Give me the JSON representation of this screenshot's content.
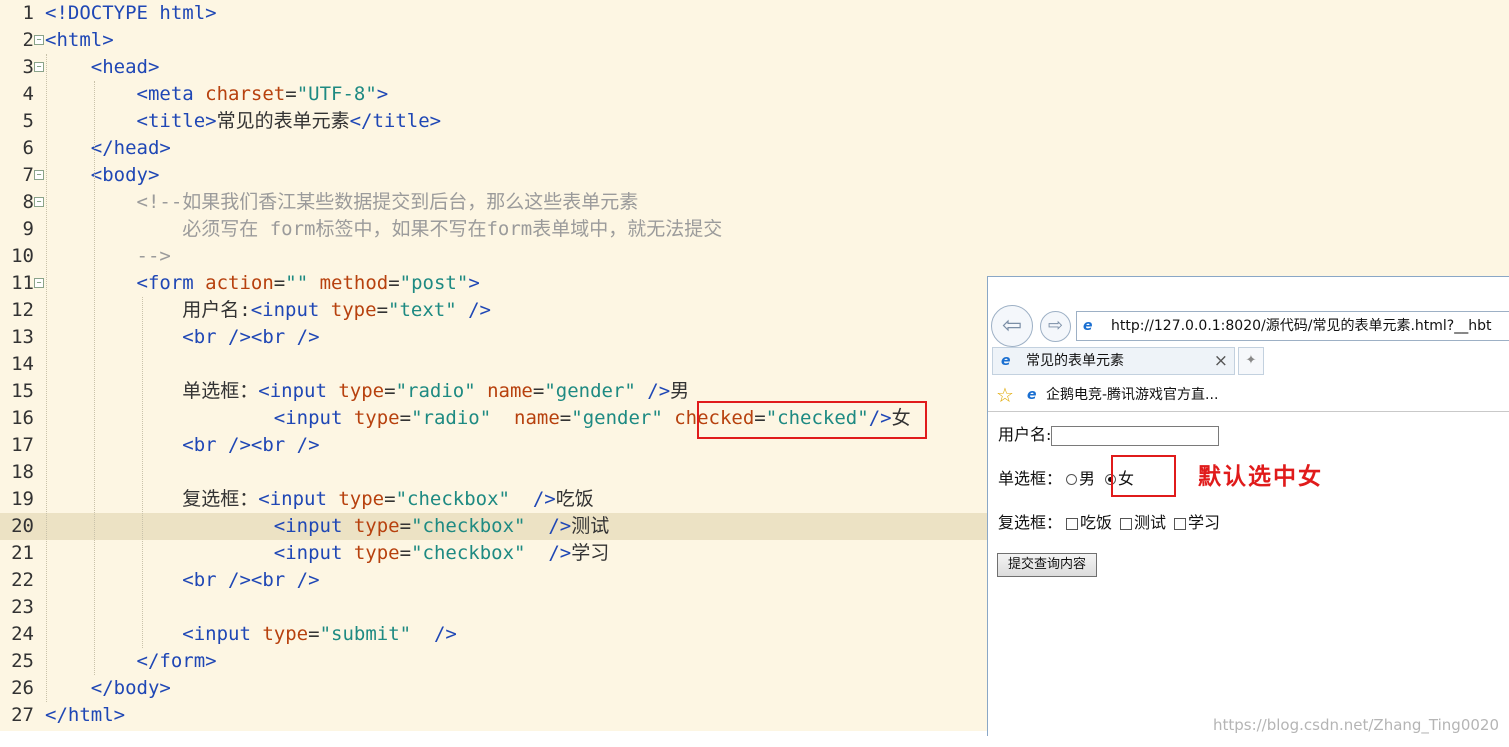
{
  "editor": {
    "lines": [
      {
        "num": "1",
        "fold": false,
        "segs": [
          [
            "tag",
            "<!DOCTYPE html>"
          ]
        ]
      },
      {
        "num": "2",
        "fold": true,
        "segs": [
          [
            "tag",
            "<html>"
          ]
        ]
      },
      {
        "num": "3",
        "fold": true,
        "segs": [
          [
            "txt",
            "    "
          ],
          [
            "tag",
            "<head>"
          ]
        ]
      },
      {
        "num": "4",
        "fold": false,
        "segs": [
          [
            "txt",
            "        "
          ],
          [
            "tag",
            "<meta "
          ],
          [
            "attr",
            "charset"
          ],
          [
            "txt",
            "="
          ],
          [
            "val",
            "\"UTF-8\""
          ],
          [
            "tag",
            ">"
          ]
        ]
      },
      {
        "num": "5",
        "fold": false,
        "segs": [
          [
            "txt",
            "        "
          ],
          [
            "tag",
            "<title>"
          ],
          [
            "txt",
            "常见的表单元素"
          ],
          [
            "tag",
            "</title>"
          ]
        ]
      },
      {
        "num": "6",
        "fold": false,
        "segs": [
          [
            "txt",
            "    "
          ],
          [
            "tag",
            "</head>"
          ]
        ]
      },
      {
        "num": "7",
        "fold": true,
        "segs": [
          [
            "txt",
            "    "
          ],
          [
            "tag",
            "<body>"
          ]
        ]
      },
      {
        "num": "8",
        "fold": true,
        "segs": [
          [
            "txt",
            "        "
          ],
          [
            "cmt",
            "<!--如果我们香江某些数据提交到后台，那么这些表单元素"
          ]
        ]
      },
      {
        "num": "9",
        "fold": false,
        "segs": [
          [
            "txt",
            "            "
          ],
          [
            "cmt",
            "必须写在 form标签中，如果不写在form表单域中，就无法提交"
          ]
        ]
      },
      {
        "num": "10",
        "fold": false,
        "segs": [
          [
            "txt",
            "        "
          ],
          [
            "cmt",
            "-->"
          ]
        ]
      },
      {
        "num": "11",
        "fold": true,
        "segs": [
          [
            "txt",
            "        "
          ],
          [
            "tag",
            "<form "
          ],
          [
            "attr",
            "action"
          ],
          [
            "txt",
            "="
          ],
          [
            "val",
            "\"\" "
          ],
          [
            "attr",
            "method"
          ],
          [
            "txt",
            "="
          ],
          [
            "val",
            "\"post\""
          ],
          [
            "tag",
            ">"
          ]
        ]
      },
      {
        "num": "12",
        "fold": false,
        "segs": [
          [
            "txt",
            "            用户名:"
          ],
          [
            "tag",
            "<input "
          ],
          [
            "attr",
            "type"
          ],
          [
            "txt",
            "="
          ],
          [
            "val",
            "\"text\" "
          ],
          [
            "tag",
            "/>"
          ]
        ]
      },
      {
        "num": "13",
        "fold": false,
        "segs": [
          [
            "txt",
            "            "
          ],
          [
            "tag",
            "<br /><br />"
          ]
        ]
      },
      {
        "num": "14",
        "fold": false,
        "segs": []
      },
      {
        "num": "15",
        "fold": false,
        "segs": [
          [
            "txt",
            "            单选框："
          ],
          [
            "tag",
            "<input "
          ],
          [
            "attr",
            "type"
          ],
          [
            "txt",
            "="
          ],
          [
            "val",
            "\"radio\" "
          ],
          [
            "attr",
            "name"
          ],
          [
            "txt",
            "="
          ],
          [
            "val",
            "\"gender\" "
          ],
          [
            "tag",
            "/>"
          ],
          [
            "txt",
            "男"
          ]
        ]
      },
      {
        "num": "16",
        "fold": false,
        "segs": [
          [
            "txt",
            "                    "
          ],
          [
            "tag",
            "<input "
          ],
          [
            "attr",
            "type"
          ],
          [
            "txt",
            "="
          ],
          [
            "val",
            "\"radio\"  "
          ],
          [
            "attr",
            "name"
          ],
          [
            "txt",
            "="
          ],
          [
            "val",
            "\"gender\" "
          ],
          [
            "attr",
            "checked"
          ],
          [
            "txt",
            "="
          ],
          [
            "val",
            "\"checked\""
          ],
          [
            "tag",
            "/>"
          ],
          [
            "txt",
            "女"
          ]
        ]
      },
      {
        "num": "17",
        "fold": false,
        "segs": [
          [
            "txt",
            "            "
          ],
          [
            "tag",
            "<br /><br />"
          ]
        ]
      },
      {
        "num": "18",
        "fold": false,
        "segs": []
      },
      {
        "num": "19",
        "fold": false,
        "segs": [
          [
            "txt",
            "            复选框："
          ],
          [
            "tag",
            "<input "
          ],
          [
            "attr",
            "type"
          ],
          [
            "txt",
            "="
          ],
          [
            "val",
            "\"checkbox\"  "
          ],
          [
            "tag",
            "/>"
          ],
          [
            "txt",
            "吃饭"
          ]
        ]
      },
      {
        "num": "20",
        "fold": false,
        "segs": [
          [
            "txt",
            "                    "
          ],
          [
            "tag",
            "<input "
          ],
          [
            "attr",
            "type"
          ],
          [
            "txt",
            "="
          ],
          [
            "val",
            "\"checkbox\"  "
          ],
          [
            "tag",
            "/>"
          ],
          [
            "txt",
            "测试"
          ]
        ]
      },
      {
        "num": "21",
        "fold": false,
        "segs": [
          [
            "txt",
            "                    "
          ],
          [
            "tag",
            "<input "
          ],
          [
            "attr",
            "type"
          ],
          [
            "txt",
            "="
          ],
          [
            "val",
            "\"checkbox\"  "
          ],
          [
            "tag",
            "/>"
          ],
          [
            "txt",
            "学习"
          ]
        ]
      },
      {
        "num": "22",
        "fold": false,
        "segs": [
          [
            "txt",
            "            "
          ],
          [
            "tag",
            "<br /><br />"
          ]
        ]
      },
      {
        "num": "23",
        "fold": false,
        "segs": []
      },
      {
        "num": "24",
        "fold": false,
        "segs": [
          [
            "txt",
            "            "
          ],
          [
            "tag",
            "<input "
          ],
          [
            "attr",
            "type"
          ],
          [
            "txt",
            "="
          ],
          [
            "val",
            "\"submit\"  "
          ],
          [
            "tag",
            "/>"
          ]
        ]
      },
      {
        "num": "25",
        "fold": false,
        "segs": [
          [
            "txt",
            "        "
          ],
          [
            "tag",
            "</form>"
          ]
        ]
      },
      {
        "num": "26",
        "fold": false,
        "segs": [
          [
            "txt",
            "    "
          ],
          [
            "tag",
            "</body>"
          ]
        ]
      },
      {
        "num": "27",
        "fold": false,
        "segs": [
          [
            "tag",
            "</html>"
          ]
        ]
      }
    ],
    "highlighted_line": "20"
  },
  "browser": {
    "back_icon": "back-arrow-icon",
    "forward_icon": "forward-arrow-icon",
    "address": "http://127.0.0.1:8020/源代码/常见的表单元素.html?__hbt",
    "tab_title": "常见的表单元素",
    "tab_close": "×",
    "favorites_item": "企鹅电竞-腾讯游戏官方直...",
    "form": {
      "username_label": "用户名:",
      "radio_label": "单选框：",
      "radio_male": "男",
      "radio_female": "女",
      "radio_checked": "女",
      "checkbox_label": "复选框：",
      "checkbox_options": [
        "吃饭",
        "测试",
        "学习"
      ],
      "submit_label": "提交查询内容"
    }
  },
  "annotation": "默认选中女",
  "watermark": "https://blog.csdn.net/Zhang_Ting0020",
  "colors": {
    "tag": "#1f47b5",
    "attribute": "#b7410e",
    "value": "#1e8a82",
    "comment": "#9b9b9b",
    "highlight_box": "#e01b1b",
    "editor_bg": "#fdf6e3"
  }
}
